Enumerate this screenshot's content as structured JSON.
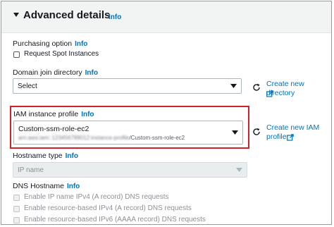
{
  "section": {
    "title": "Advanced details",
    "info": "Info"
  },
  "purchasing": {
    "label": "Purchasing option",
    "info": "Info",
    "spot_label": "Request Spot Instances"
  },
  "domain": {
    "label": "Domain join directory",
    "info": "Info",
    "value": "Select",
    "create_link": "Create new directory"
  },
  "iam": {
    "label": "IAM instance profile",
    "info": "Info",
    "value": "Custom-ssm-role-ec2",
    "arn_redacted": "arn:aws:iam::123456789012:instance-profile",
    "arn_suffix": "/Custom-ssm-role-ec2",
    "create_link_line1": "Create new IAM",
    "create_link_line2": "profile"
  },
  "hostname_type": {
    "label": "Hostname type",
    "info": "Info",
    "value": "IP name"
  },
  "dns": {
    "label": "DNS Hostname",
    "info": "Info",
    "options": [
      "Enable IP name IPv4 (A record) DNS requests",
      "Enable resource-based IPv4 (A record) DNS requests",
      "Enable resource-based IPv6 (AAAA record) DNS requests"
    ]
  },
  "colors": {
    "link": "#0073bb",
    "highlight_border": "#d0202b",
    "header_bg": "#f2f3f3"
  }
}
